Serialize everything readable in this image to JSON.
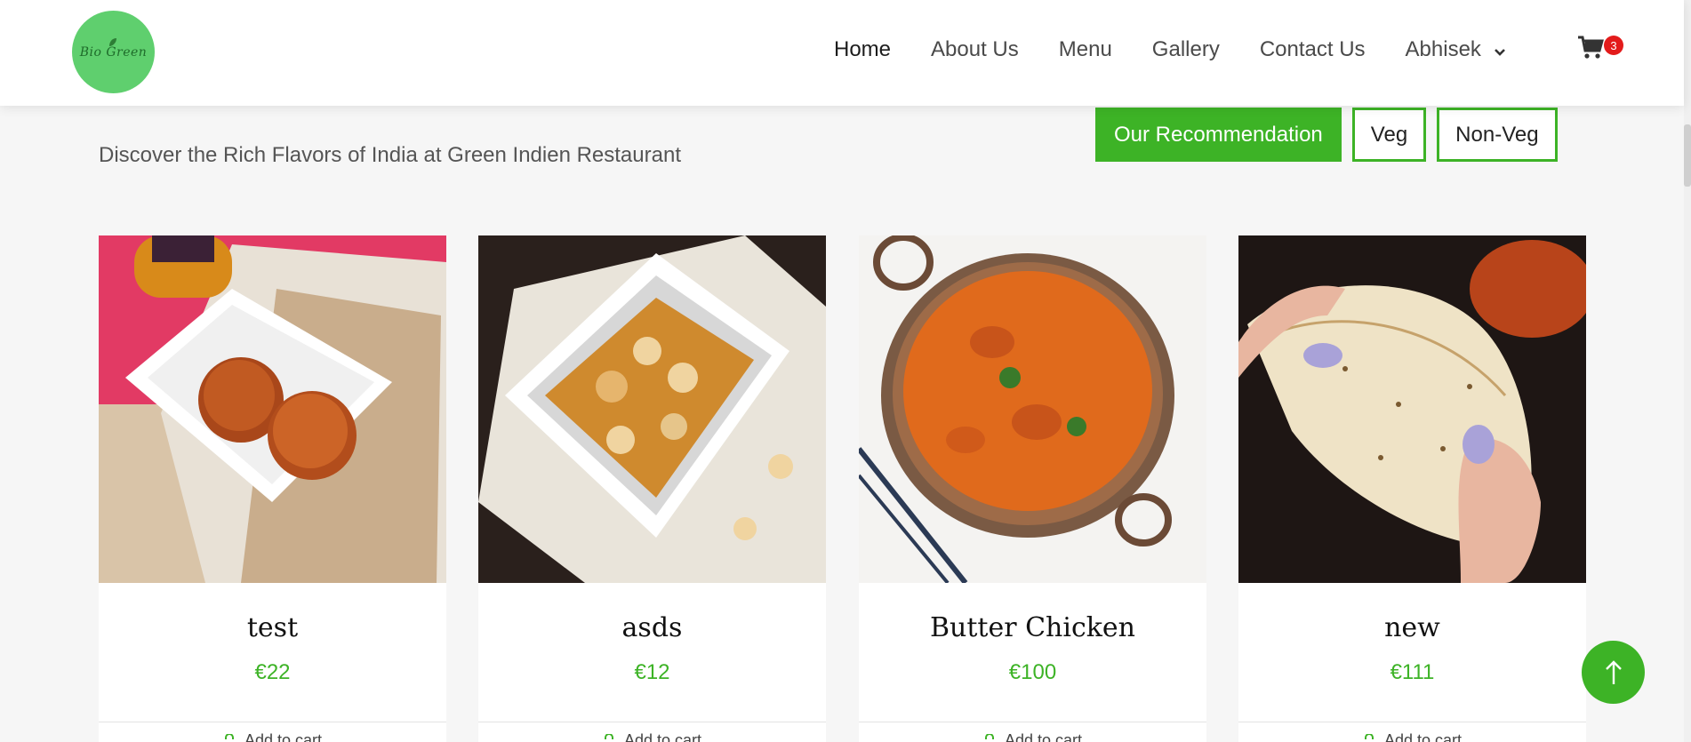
{
  "brand": {
    "logo_text": "Bio Green"
  },
  "nav": {
    "items": [
      "Home",
      "About Us",
      "Menu",
      "Gallery",
      "Contact Us"
    ],
    "user": "Abhisek",
    "cart_count": "3"
  },
  "colors": {
    "accent": "#3db326",
    "badge": "#e31b1b",
    "logo_bg": "#5fcf6e"
  },
  "tagline": "Discover the Rich Flavors of India at Green Indien Restaurant",
  "filters": [
    "Our Recommendation",
    "Veg",
    "Non-Veg"
  ],
  "cards": [
    {
      "name": "test",
      "price": "€22",
      "cart_label": "Add to cart",
      "image": "gulab-jamun"
    },
    {
      "name": "asds",
      "price": "€12",
      "cart_label": "Add to cart",
      "image": "cashew-halwa"
    },
    {
      "name": "Butter Chicken",
      "price": "€100",
      "cart_label": "Add to cart",
      "image": "butter-chicken"
    },
    {
      "name": "new",
      "price": "€111",
      "cart_label": "Add to cart",
      "image": "papad"
    }
  ],
  "icons": {
    "cart": "cart-icon",
    "chevron": "chevron-down-icon",
    "scroll_top": "arrow-up-icon",
    "add_cart": "cart-add-icon"
  }
}
